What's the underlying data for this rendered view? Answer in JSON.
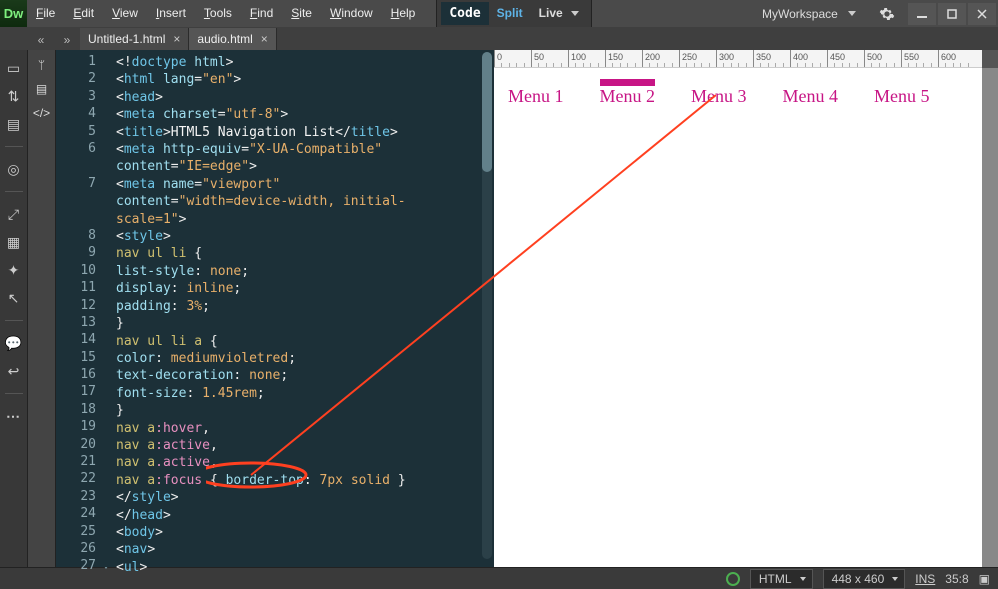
{
  "app": {
    "logo": "Dw"
  },
  "menus": [
    "File",
    "Edit",
    "View",
    "Insert",
    "Tools",
    "Find",
    "Site",
    "Window",
    "Help"
  ],
  "view_switch": {
    "code": "Code",
    "split": "Split",
    "live": "Live"
  },
  "workspace": {
    "name": "MyWorkspace"
  },
  "doctabs": [
    {
      "label": "Untitled-1.html",
      "active": true
    },
    {
      "label": "audio.html",
      "active": false
    }
  ],
  "code_lines": [
    {
      "n": 1,
      "fold": false,
      "html": "<span class='t-punc'>&lt;!</span><span class='t-tag'>doctype</span> <span class='t-attr'>html</span><span class='t-punc'>&gt;</span>"
    },
    {
      "n": 2,
      "fold": true,
      "html": "<span class='t-punc'>&lt;</span><span class='t-tag'>html</span> <span class='t-attr'>lang</span>=<span class='t-str'>\"en\"</span><span class='t-punc'>&gt;</span>"
    },
    {
      "n": 3,
      "fold": true,
      "html": "<span class='t-punc'>&lt;</span><span class='t-tag'>head</span><span class='t-punc'>&gt;</span>"
    },
    {
      "n": 4,
      "fold": false,
      "html": "<span class='t-punc'>&lt;</span><span class='t-tag'>meta</span> <span class='t-attr'>charset</span>=<span class='t-str'>\"utf-8\"</span><span class='t-punc'>&gt;</span>"
    },
    {
      "n": 5,
      "fold": false,
      "html": "<span class='t-punc'>&lt;</span><span class='t-tag'>title</span><span class='t-punc'>&gt;</span><span class='t-txt'>HTML5 Navigation List</span><span class='t-punc'>&lt;/</span><span class='t-tag'>title</span><span class='t-punc'>&gt;</span>"
    },
    {
      "n": 6,
      "fold": false,
      "html": "<span class='t-punc'>&lt;</span><span class='t-tag'>meta</span> <span class='t-attr'>http-equiv</span>=<span class='t-str'>\"X-UA-Compatible\"</span>\n<span class='t-attr'>content</span>=<span class='t-str'>\"IE=edge\"</span><span class='t-punc'>&gt;</span>"
    },
    {
      "n": 7,
      "fold": false,
      "html": "<span class='t-punc'>&lt;</span><span class='t-tag'>meta</span> <span class='t-attr'>name</span>=<span class='t-str'>\"viewport\"</span>\n<span class='t-attr'>content</span>=<span class='t-str'>\"width=device-width, initial-\nscale=1\"</span><span class='t-punc'>&gt;</span>"
    },
    {
      "n": 8,
      "fold": true,
      "html": "<span class='t-punc'>&lt;</span><span class='t-tag'>style</span><span class='t-punc'>&gt;</span>"
    },
    {
      "n": 9,
      "fold": true,
      "html": "<span class='t-sel'>nav ul li</span> <span class='t-punc'>{</span>"
    },
    {
      "n": 10,
      "fold": false,
      "html": "<span class='t-prop'>list-style</span>: <span class='t-val'>none</span>;"
    },
    {
      "n": 11,
      "fold": false,
      "html": "<span class='t-prop'>display</span>: <span class='t-val'>inline</span>;"
    },
    {
      "n": 12,
      "fold": false,
      "html": "<span class='t-prop'>padding</span>: <span class='t-val'>3%</span>;"
    },
    {
      "n": 13,
      "fold": false,
      "html": "<span class='t-punc'>}</span>"
    },
    {
      "n": 14,
      "fold": true,
      "html": "<span class='t-sel'>nav ul li a</span> <span class='t-punc'>{</span>"
    },
    {
      "n": 15,
      "fold": false,
      "html": "<span class='t-prop'>color</span>: <span class='t-val'>mediumvioletred</span>;"
    },
    {
      "n": 16,
      "fold": false,
      "html": "<span class='t-prop'>text-decoration</span>: <span class='t-val'>none</span>;"
    },
    {
      "n": 17,
      "fold": false,
      "html": "<span class='t-prop'>font-size</span>: <span class='t-val'>1.45rem</span>;"
    },
    {
      "n": 18,
      "fold": false,
      "html": "<span class='t-punc'>}</span>"
    },
    {
      "n": 19,
      "fold": false,
      "html": "<span class='t-sel'>nav a</span><span class='t-kw'>:hover</span>,"
    },
    {
      "n": 20,
      "fold": false,
      "html": "<span class='t-sel'>nav a</span><span class='t-kw'>:active</span>,"
    },
    {
      "n": 21,
      "fold": false,
      "html": "<span class='t-sel'>nav a</span><span class='t-kw'>.active</span>,"
    },
    {
      "n": 22,
      "fold": false,
      "html": "<span class='t-sel'>nav a</span><span class='t-kw'>:focus</span> <span class='t-punc'>{</span> <span class='t-prop'>border-top</span>: <span class='t-val'>7px</span> <span class='t-val'>solid</span> <span class='t-punc'>}</span>"
    },
    {
      "n": 23,
      "fold": false,
      "html": "<span class='t-punc'>&lt;/</span><span class='t-tag'>style</span><span class='t-punc'>&gt;</span>"
    },
    {
      "n": 24,
      "fold": false,
      "html": "<span class='t-punc'>&lt;/</span><span class='t-tag'>head</span><span class='t-punc'>&gt;</span>"
    },
    {
      "n": 25,
      "fold": true,
      "html": "<span class='t-punc'>&lt;</span><span class='t-tag'>body</span><span class='t-punc'>&gt;</span>"
    },
    {
      "n": 26,
      "fold": true,
      "html": "<span class='t-punc'>&lt;</span><span class='t-tag'>nav</span><span class='t-punc'>&gt;</span>"
    },
    {
      "n": 27,
      "fold": true,
      "html": "<span class='t-punc'>&lt;</span><span class='t-tag'>ul</span><span class='t-punc'>&gt;</span>"
    }
  ],
  "preview": {
    "menu_items": [
      "Menu 1",
      "Menu 2",
      "Menu 3",
      "Menu 4",
      "Menu 5"
    ],
    "active_index": 1
  },
  "ruler_ticks": [
    0,
    50,
    100,
    150,
    200,
    250,
    300,
    350,
    400,
    450,
    500,
    550,
    600
  ],
  "statusbar": {
    "lang": "HTML",
    "size": "448 x 460",
    "mode": "INS",
    "pos": "35:8"
  }
}
